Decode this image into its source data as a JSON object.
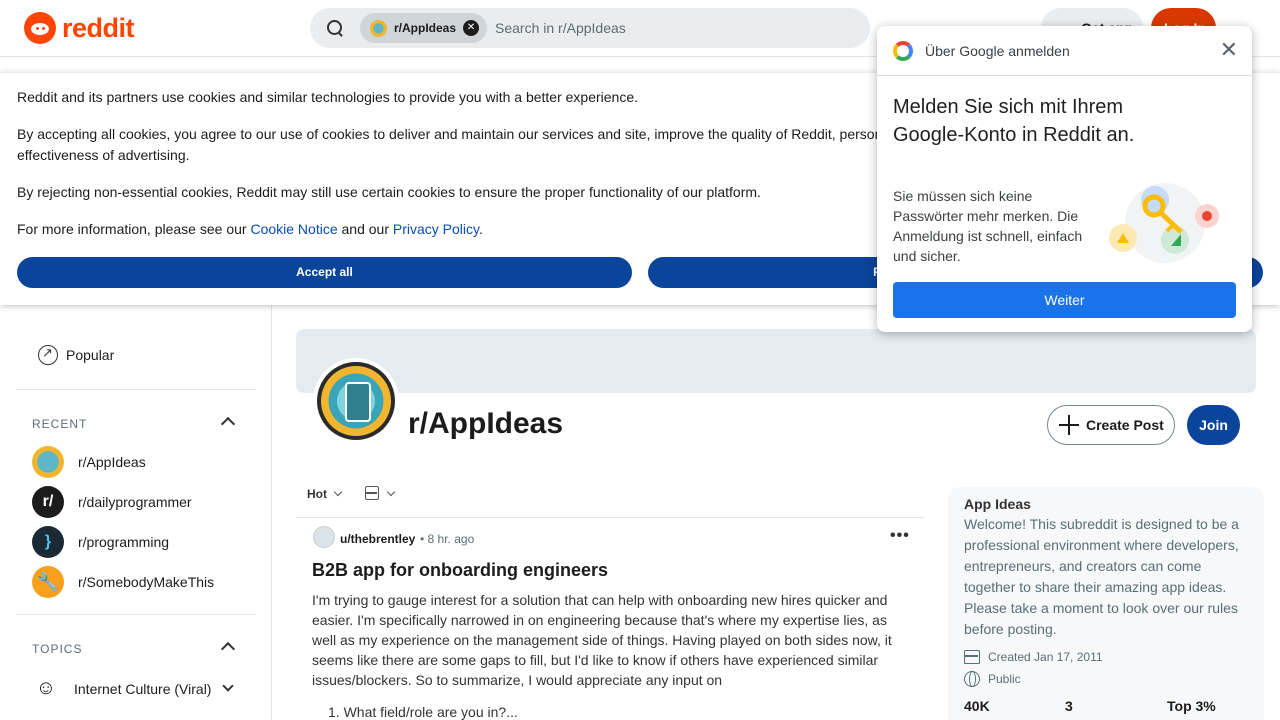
{
  "header": {
    "logo_text": "reddit",
    "search_chip": "r/AppIdeas",
    "search_placeholder": "Search in r/AppIdeas",
    "get_app": "Get app",
    "login": "Log In"
  },
  "cookie_banner": {
    "line1": "Reddit and its partners use cookies and similar technologies to provide you with a better experience.",
    "line2": "By accepting all cookies, you agree to our use of cookies to deliver and maintain our services and site, improve the quality of Reddit, personalize Reddit content and advertising, and measure the effectiveness of advertising.",
    "line3": "By rejecting non-essential cookies, Reddit may still use certain cookies to ensure the proper functionality of our platform.",
    "line4_prefix": "For more information, please see our ",
    "cookie_notice": "Cookie Notice",
    "line4_mid": " and our ",
    "privacy_policy": "Privacy Policy",
    "line4_suffix": ".",
    "accept_all": "Accept all",
    "reject": "Reject non-essential cookies"
  },
  "google_popup": {
    "title": "Über Google anmelden",
    "heading": "Melden Sie sich mit Ihrem Google-Konto in Reddit an.",
    "body": "Sie müssen sich keine Passwörter mehr merken. Die Anmeldung ist schnell, einfach und sicher.",
    "button": "Weiter"
  },
  "sidebar": {
    "popular": "Popular",
    "recent_header": "RECENT",
    "recent": [
      {
        "label": "r/AppIdeas"
      },
      {
        "label": "r/dailyprogrammer",
        "glyph": "r/"
      },
      {
        "label": "r/programming",
        "glyph": "}"
      },
      {
        "label": "r/SomebodyMakeThis"
      }
    ],
    "topics_header": "TOPICS",
    "topics": [
      {
        "label": "Internet Culture (Viral)"
      }
    ]
  },
  "subreddit": {
    "name": "r/AppIdeas",
    "create_post": "Create Post",
    "join": "Join"
  },
  "feed": {
    "sort": "Hot"
  },
  "post": {
    "user": "u/thebrentley",
    "time": "• 8 hr. ago",
    "more": "•••",
    "title": "B2B app for onboarding engineers",
    "body": "I'm trying to gauge interest for a solution that can help with onboarding new hires quicker and easier. I'm specifically narrowed in on engineering because that's where my expertise lies, as well as my experience on the management side of things. Having played on both sides now, it seems like there are some gaps to fill, but I'd like to know if others have experienced similar issues/blockers. So to summarize, I would appreciate any input on",
    "list_item": "1.  What field/role are you in?..."
  },
  "about": {
    "title": "App Ideas",
    "description": "Welcome! This subreddit is designed to be a professional environment where developers, entrepreneurs, and creators can come together to share their amazing app ideas. Please take a moment to look over our rules before posting.",
    "created": "Created Jan 17, 2011",
    "visibility": "Public",
    "stats": [
      "40K",
      "3",
      "Top 3%"
    ]
  },
  "colors": {
    "brand": "#ff4500",
    "button_blue": "#0a449b",
    "google_blue": "#1a73e8",
    "link": "#0a4bb5"
  },
  "icons": [
    "search-icon",
    "close-icon",
    "google-icon",
    "popular-icon",
    "chevron-up-icon",
    "chevron-down-icon",
    "plus-icon",
    "view-icon",
    "more-icon",
    "cake-icon",
    "globe-icon"
  ]
}
